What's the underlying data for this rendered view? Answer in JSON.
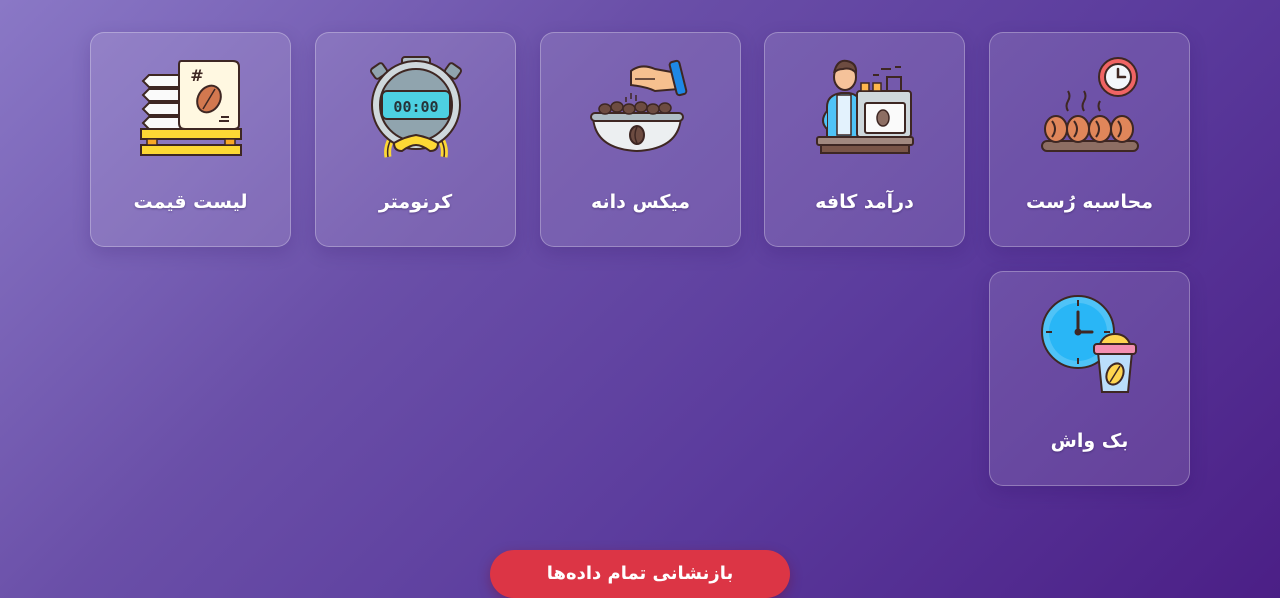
{
  "tools": [
    {
      "id": "roast",
      "label": "محاسبه رُست",
      "icon": "roasting-beans-timer-icon"
    },
    {
      "id": "cafe",
      "label": "درآمد کافه",
      "icon": "barista-espresso-machine-icon"
    },
    {
      "id": "mix",
      "label": "میکس دانه",
      "icon": "hand-mixing-beans-bowl-icon"
    },
    {
      "id": "chrono",
      "label": "کرنومتر",
      "icon": "stopwatch-icon"
    },
    {
      "id": "price",
      "label": "لیست قیمت",
      "icon": "coffee-sacks-price-list-icon"
    },
    {
      "id": "backwash",
      "label": "بک واش",
      "icon": "clock-coffee-cup-icon"
    }
  ],
  "reset_button": {
    "label": "بازنشانی تمام داده‌ها"
  },
  "colors": {
    "background_start": "#8a78c6",
    "background_end": "#4b1f86",
    "reset_button": "#dc3545",
    "card_border": "rgba(255,255,255,0.28)"
  }
}
